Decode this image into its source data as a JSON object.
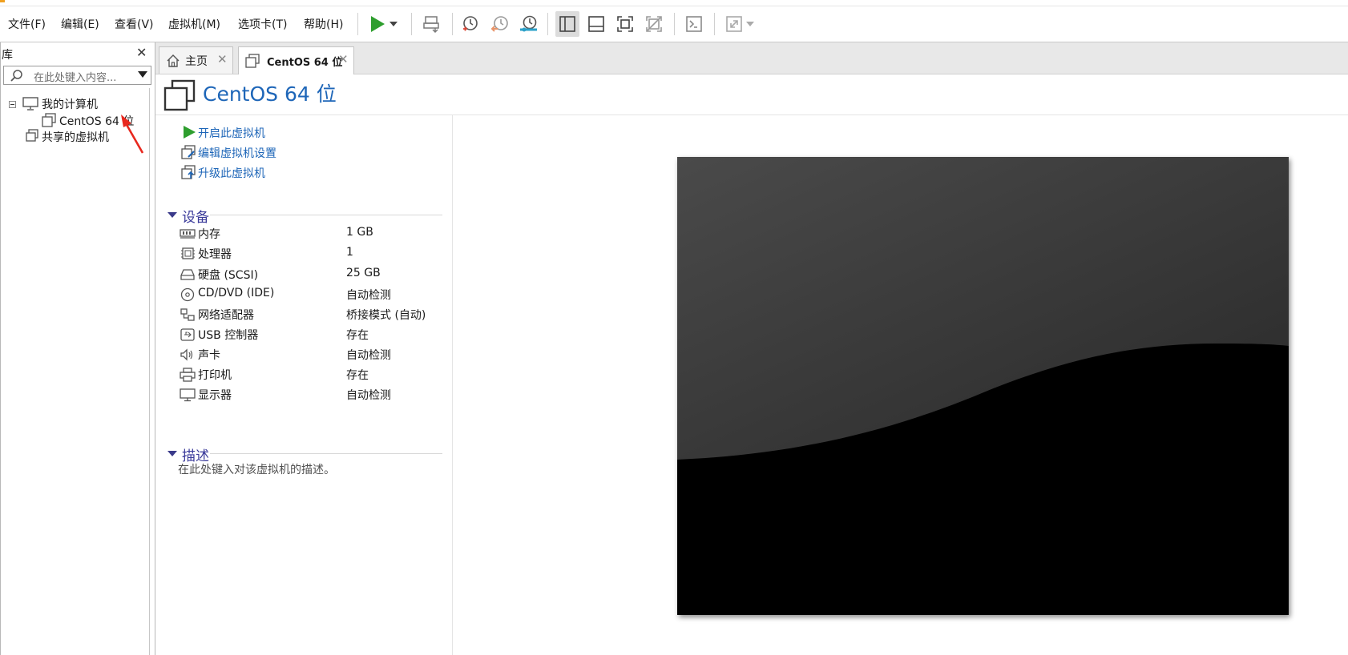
{
  "menu": [
    {
      "key": "file",
      "label": "文件(F)"
    },
    {
      "key": "edit",
      "label": "编辑(E)"
    },
    {
      "key": "view",
      "label": "查看(V)"
    },
    {
      "key": "vm",
      "label": "虚拟机(M)"
    },
    {
      "key": "tabs",
      "label": "选项卡(T)"
    },
    {
      "key": "help",
      "label": "帮助(H)"
    }
  ],
  "toolbar_icons": [
    "play-icon",
    "dropdown-icon",
    "send-keys-icon",
    "snapshot-icon",
    "snapshot-revert-icon",
    "snapshot-manager-icon",
    "sidebar-layout-icon",
    "bottom-panel-icon",
    "fullscreen-icon",
    "unity-icon",
    "console-icon",
    "stretch-icon"
  ],
  "library": {
    "title": "库",
    "search_placeholder": "在此处键入内容...",
    "tree": {
      "my_computer": "我的计算机",
      "vm_item": "CentOS 64 位",
      "shared_vms": "共享的虚拟机"
    }
  },
  "tabs": [
    {
      "label": "主页",
      "icon": "home-icon"
    },
    {
      "label": "CentOS 64 位",
      "icon": "vm-icon",
      "active": true
    }
  ],
  "vm": {
    "title": "CentOS 64 位",
    "actions": [
      {
        "label": "开启此虚拟机",
        "icon": "power-on-icon"
      },
      {
        "label": "编辑虚拟机设置",
        "icon": "edit-settings-icon"
      },
      {
        "label": "升级此虚拟机",
        "icon": "upgrade-icon"
      }
    ],
    "devices_title": "设备",
    "devices": [
      {
        "name": "内存",
        "value": "1 GB",
        "icon": "memory-icon"
      },
      {
        "name": "处理器",
        "value": "1",
        "icon": "cpu-icon"
      },
      {
        "name": "硬盘 (SCSI)",
        "value": "25 GB",
        "icon": "hard-disk-icon"
      },
      {
        "name": "CD/DVD (IDE)",
        "value": "自动检测",
        "icon": "cd-dvd-icon"
      },
      {
        "name": "网络适配器",
        "value": "桥接模式 (自动)",
        "icon": "network-adapter-icon"
      },
      {
        "name": "USB 控制器",
        "value": "存在",
        "icon": "usb-icon"
      },
      {
        "name": "声卡",
        "value": "自动检测",
        "icon": "sound-card-icon"
      },
      {
        "name": "打印机",
        "value": "存在",
        "icon": "printer-icon"
      },
      {
        "name": "显示器",
        "value": "自动检测",
        "icon": "display-icon"
      }
    ],
    "description_title": "描述",
    "description_placeholder": "在此处键入对该虚拟机的描述。"
  },
  "colors": {
    "link_blue": "#1e66b8",
    "section_purple": "#3a3a9a",
    "play_green": "#2e9e2e",
    "annotation_red": "#e8281e"
  }
}
